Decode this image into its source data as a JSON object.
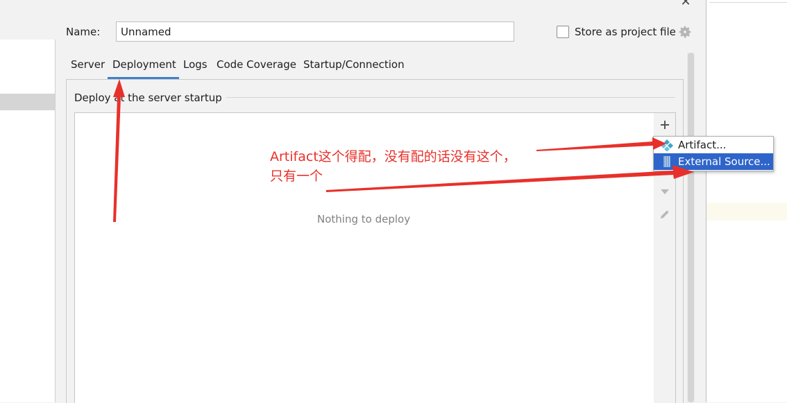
{
  "dialog": {
    "name_label": "Name:",
    "name_value": "Unnamed",
    "store_label": "Store as project file",
    "store_checked": false
  },
  "tabs": [
    {
      "label": "Server",
      "active": false
    },
    {
      "label": "Deployment",
      "active": true
    },
    {
      "label": "Logs",
      "active": false
    },
    {
      "label": "Code Coverage",
      "active": false
    },
    {
      "label": "Startup/Connection",
      "active": false
    }
  ],
  "deployment": {
    "section_title": "Deploy at the server startup",
    "empty_text": "Nothing to deploy"
  },
  "menu": {
    "items": [
      {
        "label": "Artifact...",
        "icon": "artifact-icon",
        "selected": false
      },
      {
        "label": "External Source...",
        "icon": "external-source-icon",
        "selected": true
      }
    ]
  },
  "annotation": {
    "line1": "Artifact这个得配，没有配的话没有这个，",
    "line2": "只有一个",
    "color": "#e8302a"
  },
  "colors": {
    "accent": "#3d82c8",
    "menu_selected": "#2f65ca",
    "annotation": "#e8302a"
  }
}
